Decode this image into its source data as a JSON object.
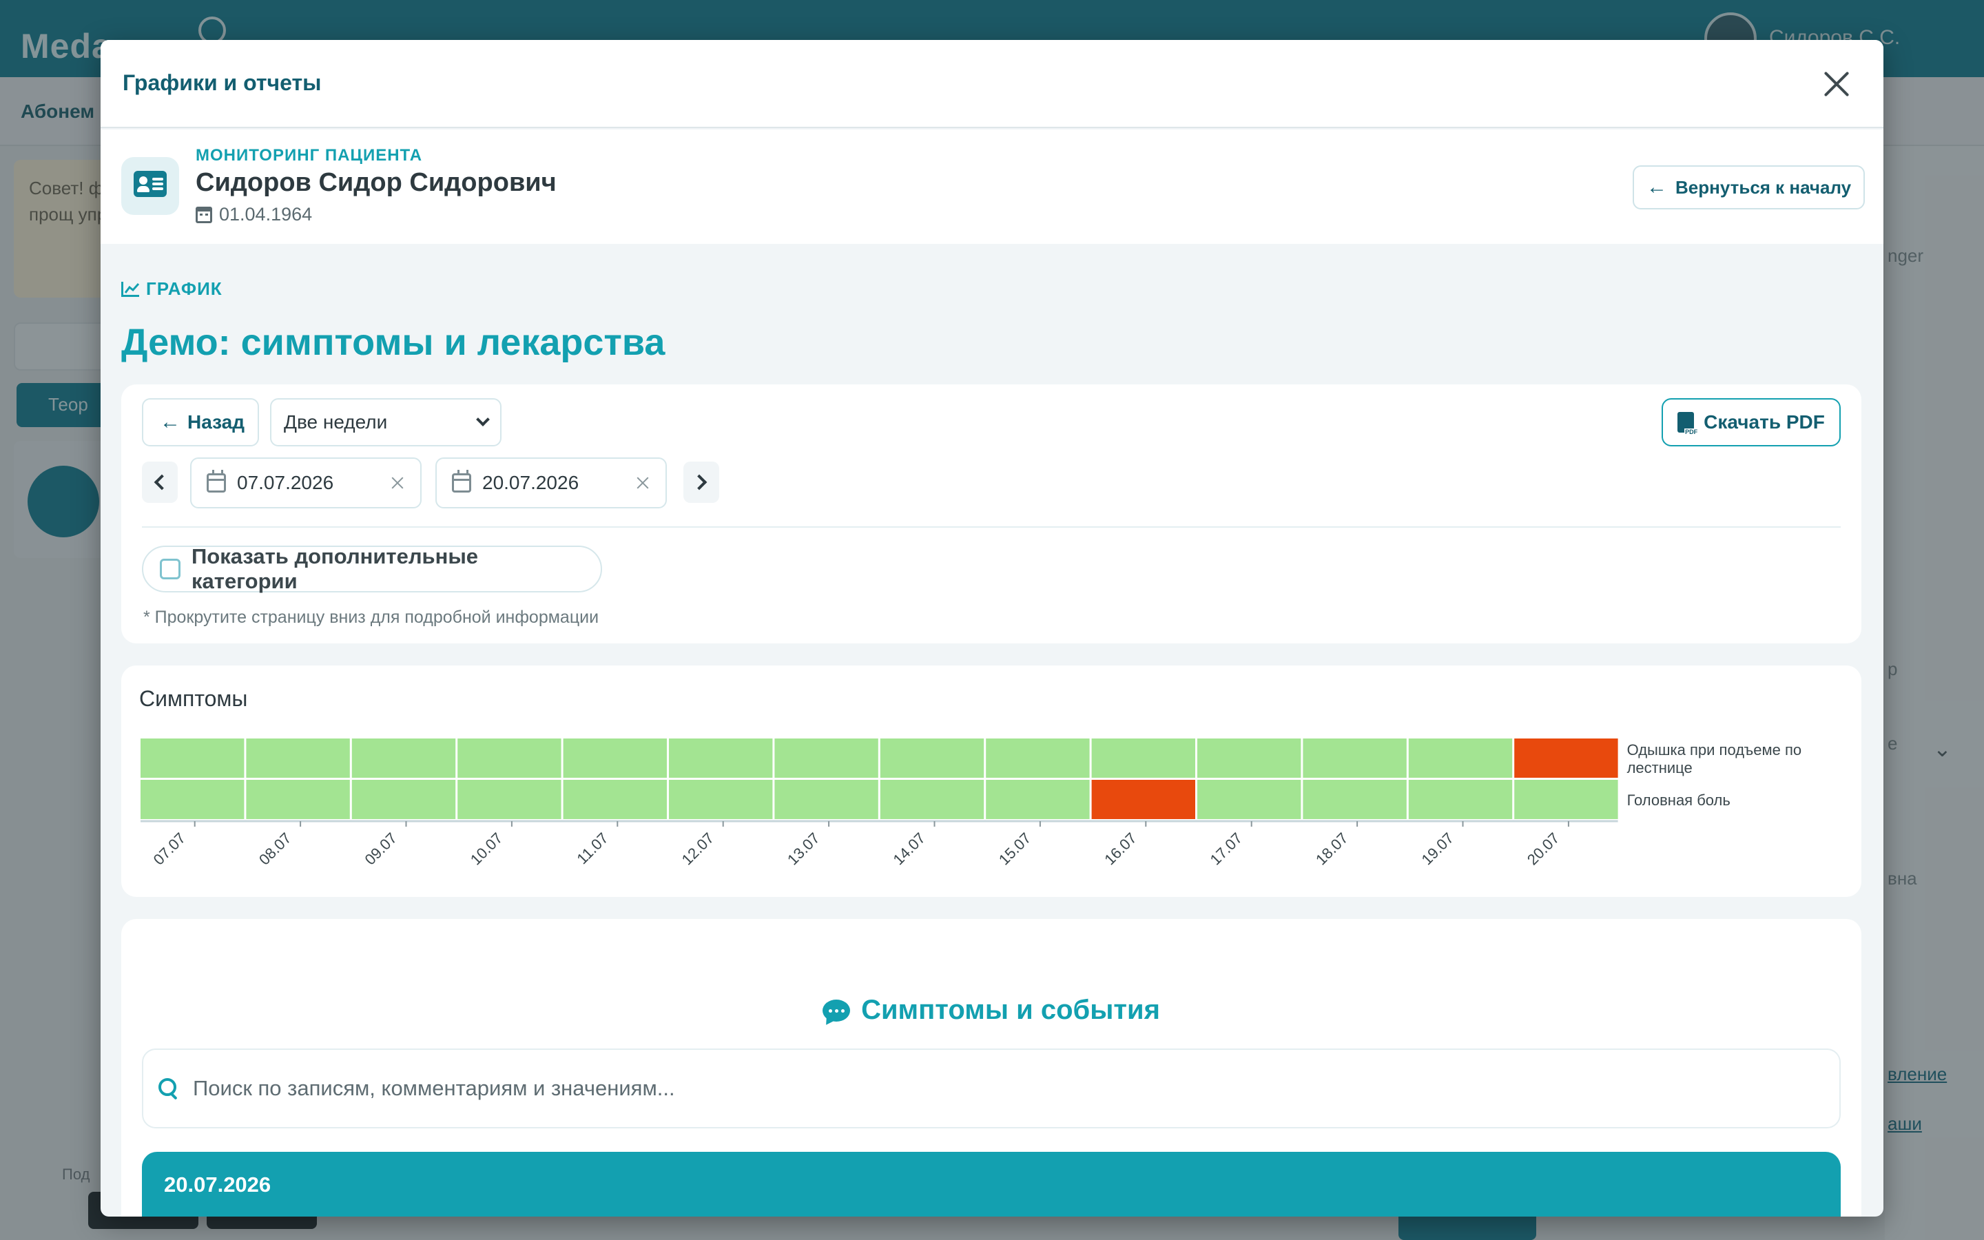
{
  "background": {
    "logo": "Meda",
    "user_name": "Сидоров С.С.",
    "subbar_label": "Абонем",
    "hint_text": "Совет! фотогр прощ упрост",
    "button_label": "Теор",
    "right_text_1": "nger",
    "right_text_2": "р",
    "right_text_3": "е",
    "right_text_4": "вна",
    "right_link_1": "вление",
    "right_link_2": "аши",
    "footer_label": "Под"
  },
  "modal": {
    "title": "Графики и отчеты",
    "close_label": "Закрыть"
  },
  "patient": {
    "kicker": "МОНИТОРИНГ ПАЦИЕНТА",
    "name": "Сидоров Сидор Сидорович",
    "dob": "01.04.1964",
    "back_to_start": "Вернуться к началу"
  },
  "section": {
    "kicker": "ГРАФИК",
    "title": "Демо: симптомы и лекарства"
  },
  "controls": {
    "back": "Назад",
    "period": "Две недели",
    "period_options": [
      "Две недели"
    ],
    "download_pdf": "Скачать PDF",
    "date_from": "07.07.2026",
    "date_to": "20.07.2026",
    "show_extra_categories": "Показать дополнительные категории",
    "show_extra_checked": false,
    "scroll_hint": "* Прокрутите страницу вниз для подробной информации"
  },
  "chart_data": {
    "type": "heatmap",
    "title": "Симптомы",
    "categories": [
      "07.07",
      "08.07",
      "09.07",
      "10.07",
      "11.07",
      "12.07",
      "13.07",
      "14.07",
      "15.07",
      "16.07",
      "17.07",
      "18.07",
      "19.07",
      "20.07"
    ],
    "rows": [
      {
        "name": "Одышка при подъеме по лестнице",
        "label_lines": [
          "Одышка при подъеме по",
          "лестнице"
        ],
        "values": [
          0,
          0,
          0,
          0,
          0,
          0,
          0,
          0,
          0,
          0,
          0,
          0,
          0,
          1
        ]
      },
      {
        "name": "Головная боль",
        "label_lines": [
          "Головная боль"
        ],
        "values": [
          0,
          0,
          0,
          0,
          0,
          0,
          0,
          0,
          0,
          1,
          0,
          0,
          0,
          0
        ]
      }
    ],
    "colors": {
      "absent": "#a3e492",
      "present": "#e8490d"
    },
    "legend": "right"
  },
  "events": {
    "title": "Симптомы и события",
    "search_placeholder": "Поиск по записям, комментариям и значениям...",
    "search_value": "",
    "first_date": "20.07.2026"
  },
  "colors": {
    "accent": "#13a0b0",
    "dark_accent": "#135e70",
    "header_bg": "#127c90"
  }
}
